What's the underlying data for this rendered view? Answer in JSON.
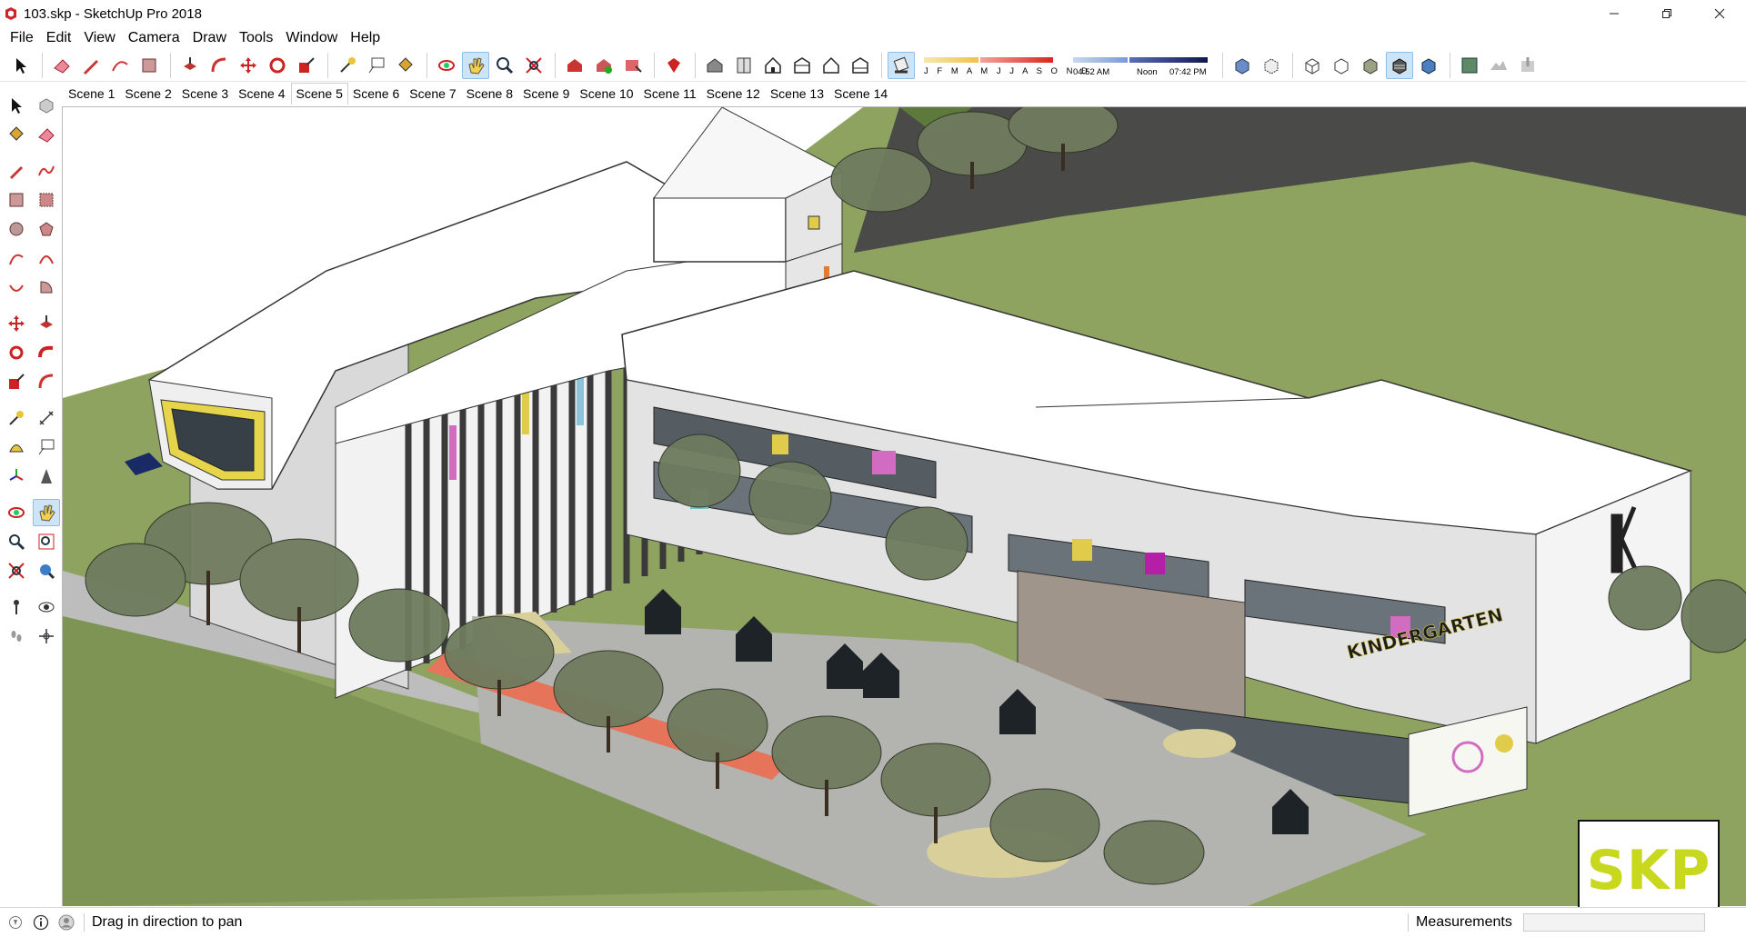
{
  "window": {
    "title": "103.skp - SketchUp Pro 2018"
  },
  "menu": [
    "File",
    "Edit",
    "View",
    "Camera",
    "Draw",
    "Tools",
    "Window",
    "Help"
  ],
  "shadows": {
    "months": "J F M A M J J A S O N D",
    "sunrise": "04:52 AM",
    "noon": "Noon",
    "sunset": "07:42 PM"
  },
  "scenes": [
    "Scene 1",
    "Scene 2",
    "Scene 3",
    "Scene 4",
    "Scene 5",
    "Scene 6",
    "Scene 7",
    "Scene 8",
    "Scene 9",
    "Scene 10",
    "Scene 11",
    "Scene 12",
    "Scene 13",
    "Scene 14"
  ],
  "active_scene": "Scene 5",
  "model": {
    "sign_text": "KINDERGARTEN",
    "logo_letter": "K"
  },
  "watermark": "SKP",
  "status": {
    "hint": "Drag in direction to pan",
    "measurements_label": "Measurements"
  },
  "colors": {
    "accent": "#cde4f7",
    "ground": "#8ea360",
    "logo": "#c8d81e"
  }
}
